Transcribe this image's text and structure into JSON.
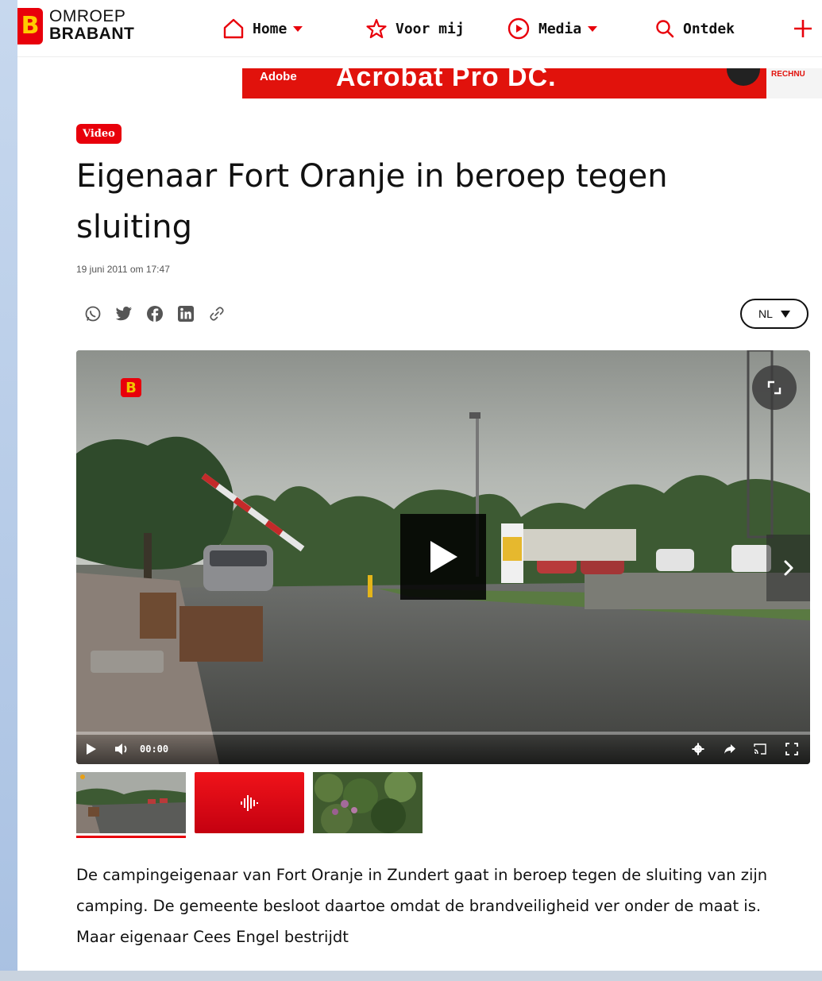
{
  "header": {
    "logo": {
      "line1": "OMROEP",
      "line2": "BRABANT",
      "mark": "B"
    },
    "nav": [
      {
        "label": "Home",
        "icon": "house-icon",
        "has_dropdown": true
      },
      {
        "label": "Voor mij",
        "icon": "star-icon",
        "has_dropdown": false
      },
      {
        "label": "Media",
        "icon": "play-circle-icon",
        "has_dropdown": true
      },
      {
        "label": "Ontdek",
        "icon": "search-icon",
        "has_dropdown": false
      }
    ],
    "more_icon": "plus-icon"
  },
  "ad": {
    "brand": "Adobe",
    "headline": "Acrobat Pro DC.",
    "doc_label": "RECHNU"
  },
  "article": {
    "badge": "Video",
    "title": "Eigenaar Fort Oranje in beroep tegen sluiting",
    "date": "19 juni 2011 om 17:47",
    "share_icons": [
      "whatsapp-icon",
      "twitter-icon",
      "facebook-icon",
      "linkedin-icon",
      "link-icon"
    ],
    "language": "NL",
    "body": "De campingeigenaar van Fort Oranje in Zundert gaat in beroep tegen de sluiting van zijn camping. De gemeente besloot daartoe omdat de brandveiligheid ver onder de maat is. Maar eigenaar Cees Engel bestrijdt"
  },
  "video": {
    "time": "00:00",
    "progress": 0,
    "watermark": "B"
  },
  "colors": {
    "brand_red": "#e8000b",
    "logo_yellow": "#ffcc00",
    "text": "#111111"
  }
}
